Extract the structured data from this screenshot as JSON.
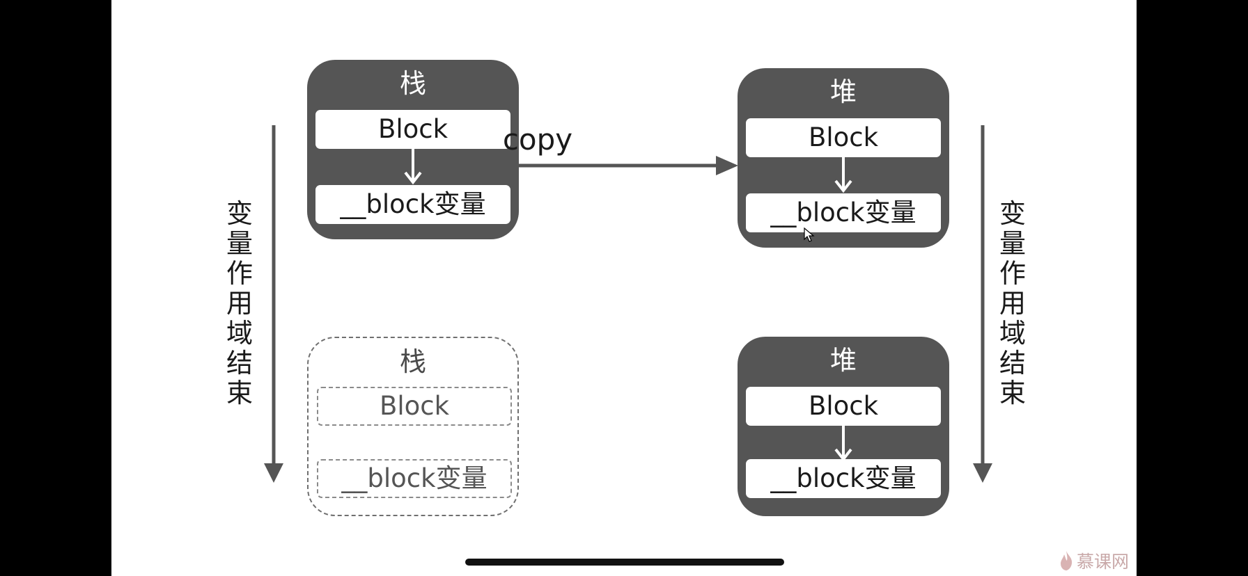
{
  "diagram": {
    "stack_top": {
      "title": "栈",
      "block": "Block",
      "var": "__block变量"
    },
    "heap_top": {
      "title": "堆",
      "block": "Block",
      "var": "__block变量"
    },
    "stack_bottom": {
      "title": "栈",
      "block": "Block",
      "var": "__block变量"
    },
    "heap_bottom": {
      "title": "堆",
      "block": "Block",
      "var": "__block变量"
    },
    "copy_label": "copy",
    "scope_end_left": "变量作用域结束",
    "scope_end_right": "变量作用域结束",
    "colors": {
      "box_fill": "#555555",
      "arrow": "#555555",
      "dashed": "#6f6f6f"
    }
  },
  "watermark": {
    "text": "慕课网",
    "icon": "flame-logo-icon"
  }
}
